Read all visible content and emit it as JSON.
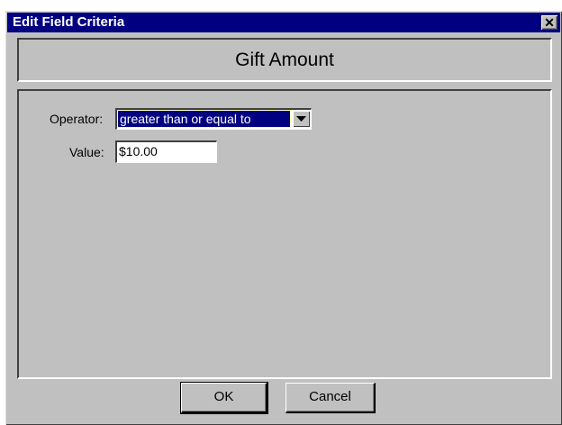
{
  "window": {
    "title": "Edit Field Criteria",
    "close_glyph": "✕"
  },
  "header": {
    "field_name": "Gift Amount"
  },
  "form": {
    "operator_label": "Operator:",
    "operator_value": "greater than or equal to",
    "value_label": "Value:",
    "value": "$10.00"
  },
  "buttons": {
    "ok": "OK",
    "cancel": "Cancel"
  },
  "icons": {
    "close": "close-icon",
    "dropdown": "chevron-down-icon"
  },
  "colors": {
    "title_bar": "#000080",
    "face": "#c0c0c0",
    "selection": "#000080"
  }
}
